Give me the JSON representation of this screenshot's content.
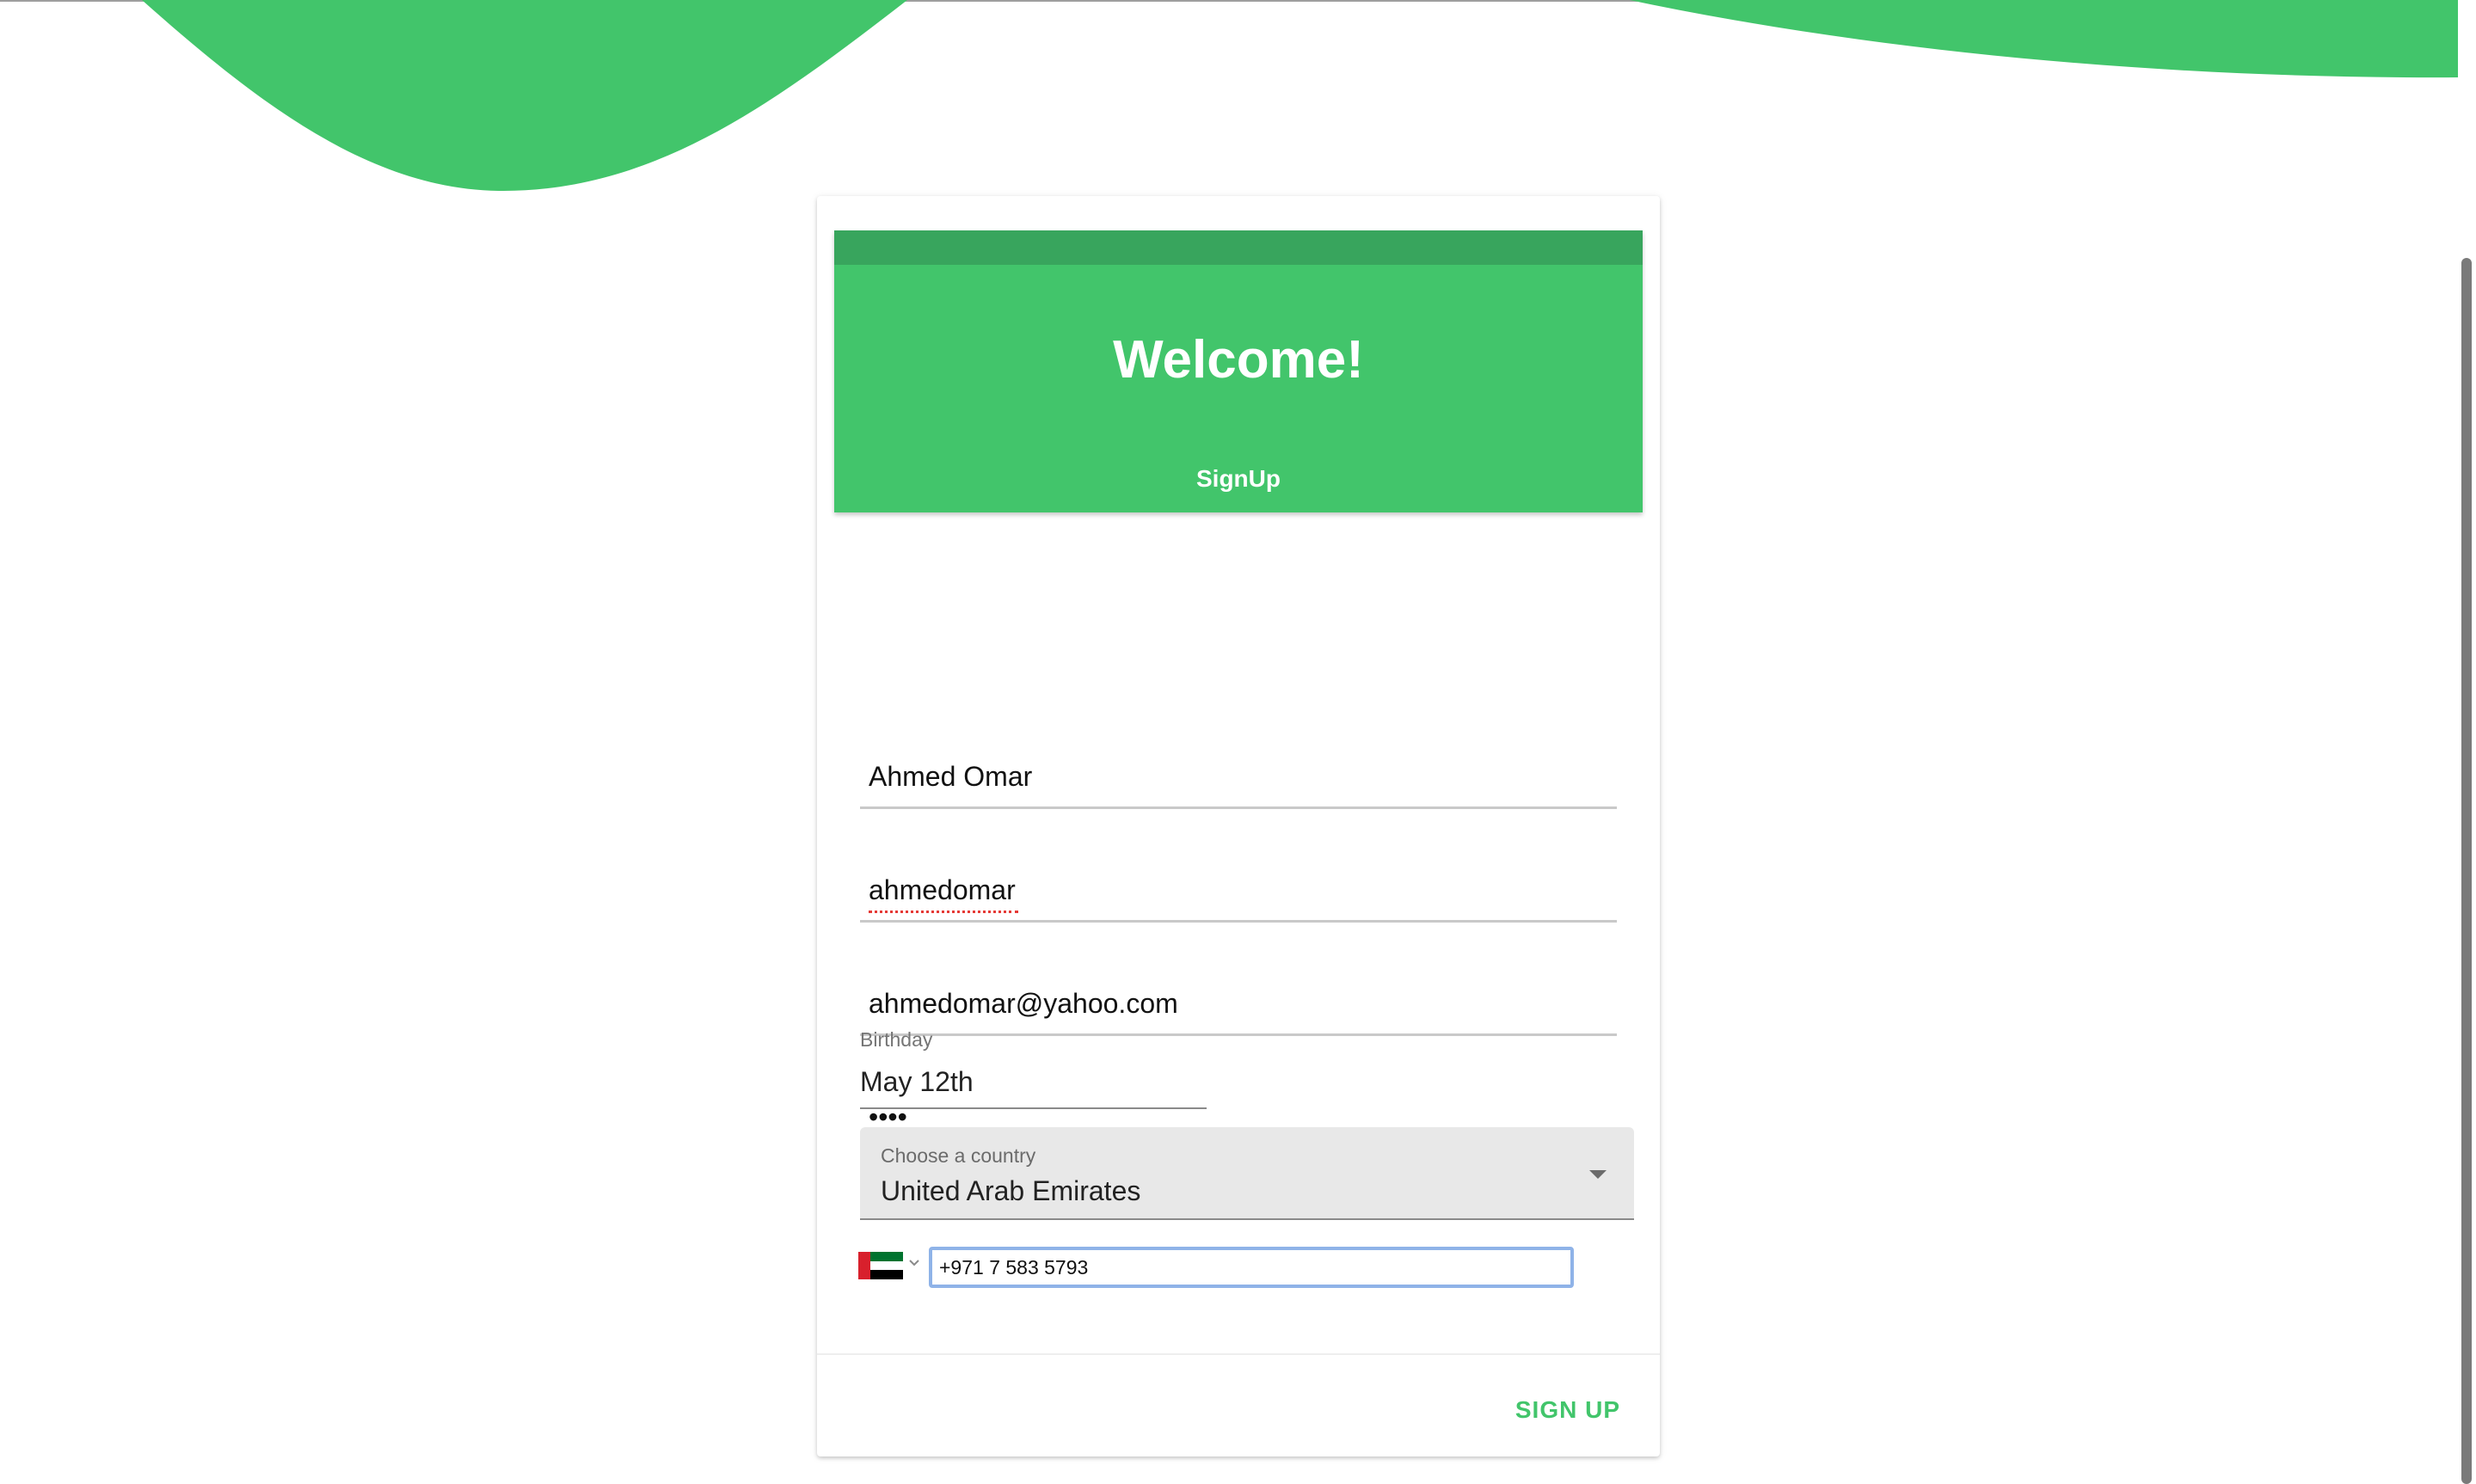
{
  "colors": {
    "brand_green": "#42c56b",
    "header_bar_green": "#38a55d",
    "focus_blue": "#8fb3e8"
  },
  "header": {
    "title": "Welcome!",
    "subtitle": "SignUp"
  },
  "form": {
    "name": {
      "value": "Ahmed Omar"
    },
    "username": {
      "value": "ahmedomar"
    },
    "email": {
      "value": "ahmedomar@yahoo.com"
    },
    "password": {
      "value": "••••"
    },
    "birthday": {
      "label": "Birthday",
      "value": "May 12th"
    },
    "country": {
      "label": "Choose a country",
      "value": "United Arab Emirates"
    },
    "phone": {
      "value": "+971 7 583 5793",
      "flag_icon": "uae-flag-icon"
    }
  },
  "actions": {
    "signup_label": "SIGN UP"
  }
}
